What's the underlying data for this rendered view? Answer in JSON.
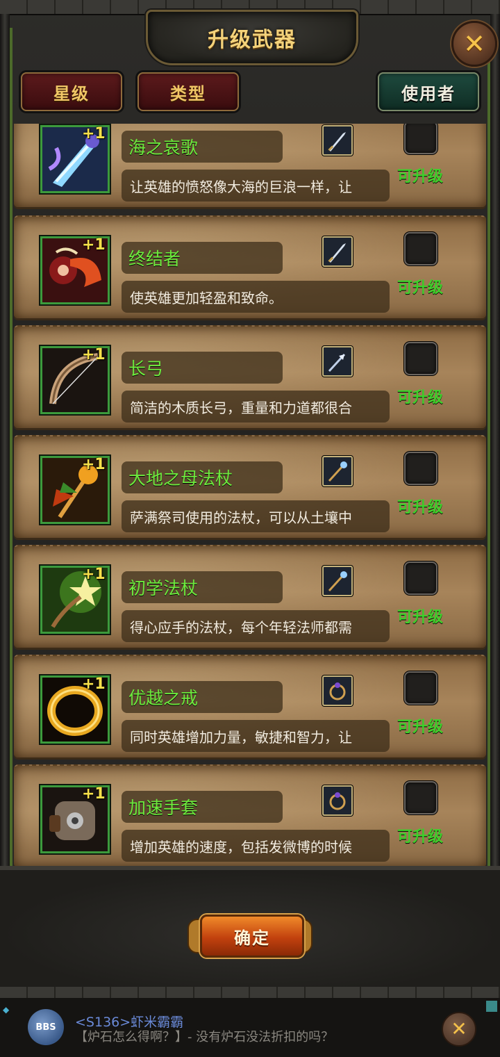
{
  "header": {
    "title": "升级武器",
    "close_icon": "close-x-icon"
  },
  "filters": [
    {
      "label": "星级",
      "style": "red"
    },
    {
      "label": "类型",
      "style": "red"
    },
    {
      "label": "使用者",
      "style": "green"
    }
  ],
  "items": [
    {
      "name": "海之哀歌",
      "desc": "让英雄的愤怒像大海的巨浪一样，让",
      "plus": "+1",
      "status": "可升级",
      "icon": "ice-sword-icon",
      "type_icon": "sword-type-icon"
    },
    {
      "name": "终结者",
      "desc": "使英雄更加轻盈和致命。",
      "plus": "+1",
      "status": "可升级",
      "icon": "dragon-blade-icon",
      "type_icon": "sword-type-icon"
    },
    {
      "name": "长弓",
      "desc": "简洁的木质长弓，重量和力道都很合",
      "plus": "+1",
      "status": "可升级",
      "icon": "longbow-icon",
      "type_icon": "arrow-type-icon"
    },
    {
      "name": "大地之母法杖",
      "desc": "萨满祭司使用的法杖，可以从土壤中",
      "plus": "+1",
      "status": "可升级",
      "icon": "earth-staff-icon",
      "type_icon": "staff-type-icon"
    },
    {
      "name": "初学法杖",
      "desc": "得心应手的法杖，每个年轻法师都需",
      "plus": "+1",
      "status": "可升级",
      "icon": "star-wand-icon",
      "type_icon": "staff-type-icon"
    },
    {
      "name": "优越之戒",
      "desc": "同时英雄增加力量，敏捷和智力，让",
      "plus": "+1",
      "status": "可升级",
      "icon": "gold-ring-icon",
      "type_icon": "ring-type-icon"
    },
    {
      "name": "加速手套",
      "desc": "增加英雄的速度，包括发微博的时候",
      "plus": "+1",
      "status": "可升级",
      "icon": "gauntlet-icon",
      "type_icon": "ring-type-icon"
    }
  ],
  "footer": {
    "confirm_label": "确定"
  },
  "chat": {
    "badge": "BBS",
    "user": "<S136>虾米霸霸",
    "message": "【炉石怎么得啊？】- 没有炉石没法折扣的吗？"
  },
  "colors": {
    "item_name": "#6dea3d",
    "upgradable": "#3fcf2b",
    "title": "#f4d27a",
    "parchment": "#a7845a"
  }
}
